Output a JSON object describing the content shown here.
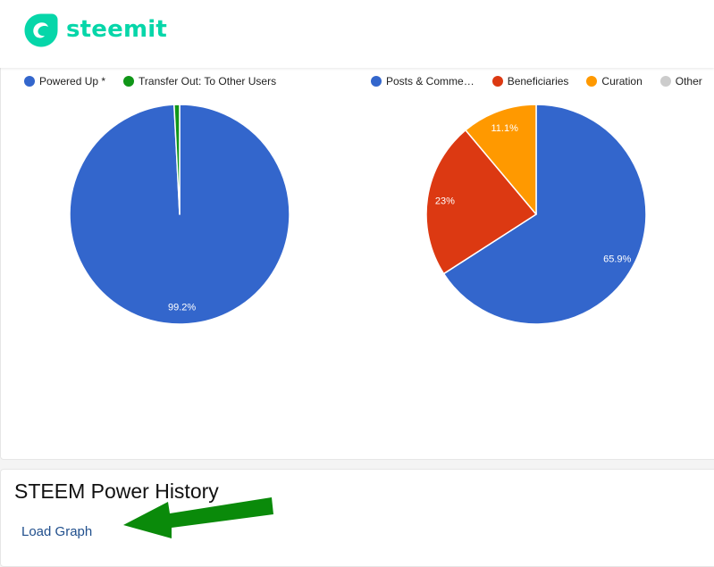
{
  "brand": {
    "name": "steemit",
    "color": "#06d6a9"
  },
  "charts": {
    "left_legend": [
      {
        "label": "Powered Up *",
        "color": "#3366cc"
      },
      {
        "label": "Transfer Out: To Other Users",
        "color": "#109618"
      }
    ],
    "right_legend": [
      {
        "label": "Posts & Comme…",
        "color": "#3366cc"
      },
      {
        "label": "Beneficiaries",
        "color": "#dc3912"
      },
      {
        "label": "Curation",
        "color": "#ff9900"
      },
      {
        "label": "Other",
        "color": "#cccccc"
      }
    ]
  },
  "chart_data": [
    {
      "type": "pie",
      "title": "",
      "categories": [
        "Powered Up *",
        "Transfer Out: To Other Users"
      ],
      "values": [
        99.2,
        0.8
      ],
      "colors": [
        "#3366cc",
        "#109618"
      ],
      "data_labels": [
        "99.2%",
        ""
      ],
      "legend": "top-left"
    },
    {
      "type": "pie",
      "title": "",
      "categories": [
        "Posts & Comme…",
        "Beneficiaries",
        "Curation",
        "Other"
      ],
      "values": [
        65.9,
        23,
        11.1,
        0
      ],
      "colors": [
        "#3366cc",
        "#dc3912",
        "#ff9900",
        "#cccccc"
      ],
      "data_labels": [
        "65.9%",
        "23%",
        "11.1%",
        ""
      ],
      "legend": "top-right"
    }
  ],
  "history": {
    "title": "STEEM Power History",
    "load_label": "Load Graph"
  },
  "annotation": {
    "arrow_color": "#0a8a0a"
  }
}
